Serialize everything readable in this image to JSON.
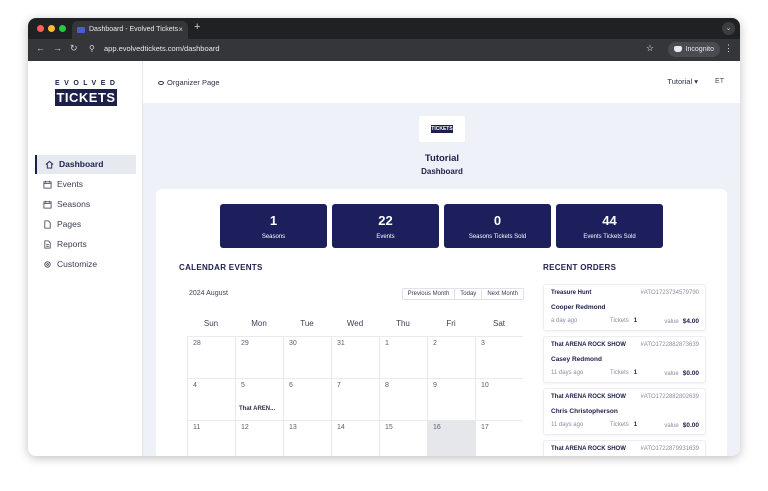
{
  "browser": {
    "tab_title": "Dashboard - Evolved Tickets",
    "tab_close": "×",
    "new_tab": "+",
    "url": "app.evolvedtickets.com/dashboard",
    "incognito_label": "Incognito",
    "traffic_lights": [
      "#ff5f57",
      "#febc2e",
      "#28c840"
    ]
  },
  "sidebar": {
    "logo_top": "EVOLVED",
    "logo_main": "TICKETS",
    "items": [
      {
        "label": "Dashboard",
        "icon": "home-icon"
      },
      {
        "label": "Events",
        "icon": "calendar-icon"
      },
      {
        "label": "Seasons",
        "icon": "calendar-icon"
      },
      {
        "label": "Pages",
        "icon": "page-icon"
      },
      {
        "label": "Reports",
        "icon": "report-icon"
      },
      {
        "label": "Customize",
        "icon": "gear-icon"
      }
    ]
  },
  "header": {
    "organizer_link": "Organizer Page",
    "tutorial_menu": "Tutorial ▾",
    "avatar": "ET"
  },
  "brand": {
    "name": "Tutorial",
    "subtitle": "Dashboard"
  },
  "stats": [
    {
      "value": "1",
      "label": "Seasons"
    },
    {
      "value": "22",
      "label": "Events"
    },
    {
      "value": "0",
      "label": "Seasons Tickets Sold"
    },
    {
      "value": "44",
      "label": "Events Tickets Sold"
    }
  ],
  "calendar": {
    "title": "CALENDAR EVENTS",
    "month": "2024 August",
    "buttons": [
      "Previous Month",
      "Today",
      "Next Month"
    ],
    "days": [
      "Sun",
      "Mon",
      "Tue",
      "Wed",
      "Thu",
      "Fri",
      "Sat"
    ],
    "weeks": [
      [
        "28",
        "29",
        "30",
        "31",
        "1",
        "2",
        "3"
      ],
      [
        "4",
        "5",
        "6",
        "7",
        "8",
        "9",
        "10"
      ],
      [
        "11",
        "12",
        "13",
        "14",
        "15",
        "16",
        "17"
      ]
    ],
    "event_label": "That AREN..."
  },
  "orders": {
    "title": "RECENT ORDERS",
    "tickets_label": "Tickets",
    "value_label": "value",
    "items": [
      {
        "event": "Treasure Hunt",
        "id": "#ATO1723734579790",
        "name": "Cooper Redmond",
        "ago": "a day ago",
        "tickets": "1",
        "value": "$4.00"
      },
      {
        "event": "That ARENA ROCK SHOW",
        "id": "#ATO1722882873639",
        "name": "Casey Redmond",
        "ago": "11 days ago",
        "tickets": "1",
        "value": "$0.00"
      },
      {
        "event": "That ARENA ROCK SHOW",
        "id": "#ATO1722882802639",
        "name": "Chris Christopherson",
        "ago": "11 days ago",
        "tickets": "1",
        "value": "$0.00"
      },
      {
        "event": "That ARENA ROCK SHOW",
        "id": "#ATO1722879931639",
        "name": "",
        "ago": "",
        "tickets": "",
        "value": ""
      }
    ]
  }
}
